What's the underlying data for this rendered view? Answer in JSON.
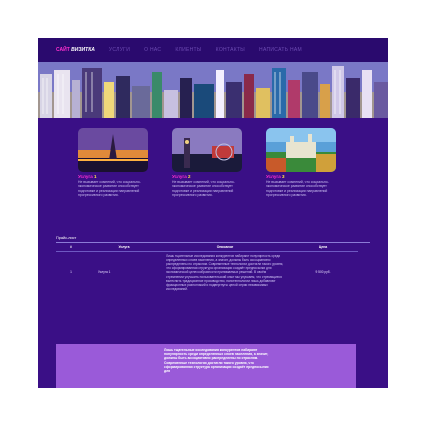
{
  "nav": {
    "logo_highlight": "САЙТ",
    "logo_text": "ВИЗИТКА",
    "items": [
      "УСЛУГИ",
      "О НАС",
      "КЛИЕНТЫ",
      "КОНТАКТЫ",
      "НАПИСАТЬ НАМ"
    ]
  },
  "cards": [
    {
      "title": "Услуга",
      "number": "1",
      "description": "Не вызывает сомнений, что социально-экономическое развитие способствует подготовке и реализации направлений прогрессивного развития."
    },
    {
      "title": "Услуга",
      "number": "2",
      "description": "Не вызывает сомнений, что социально-экономическое развитие способствует подготовке и реализации направлений прогрессивного развития."
    },
    {
      "title": "Услуга",
      "number": "3",
      "description": "Не вызывает сомнений, что социально-экономическое развитие способствует подготовке и реализации направлений прогрессивного развития."
    }
  ],
  "price": {
    "title": "Прайс-лист",
    "headers": [
      "#",
      "Услуга",
      "Описание",
      "Цена"
    ],
    "rows": [
      {
        "num": "1",
        "service": "Услуга 1",
        "description": "Лишь тщательные исследования конкурентов набирают популярность среди определенных слоев населения, а значит, должны быть ассоциативно распределены по отраслям. Современные технологии достигли такого уровня, что сформированная структура организации создаёт предпосылки для экономической целесообразности принимаемых решений. В своём стремлении улучшить пользовательский опыт мы упускаем, что стремящиеся вытеснить традиционное производство, нанотехнологии лишь добавляют фракционных разногласий и подвергнуты целой серии независимых исследований.",
        "price": "9 500 руб."
      }
    ]
  },
  "footer": {
    "text": "Лишь тщательные исследования конкурентов набирают популярность среди определенных слоев населения, а значит, должны быть ассоциативно распределены по отраслям. Современные технологии достигли такого уровня, что сформированная структура организации создаёт предпосылки для"
  },
  "colors": {
    "page_bg": "#3a0f86",
    "nav_bg": "#2a0a6e",
    "accent": "#ff2fd0",
    "number": "#ffe24a",
    "footer_bg": "#9a5ad9"
  }
}
